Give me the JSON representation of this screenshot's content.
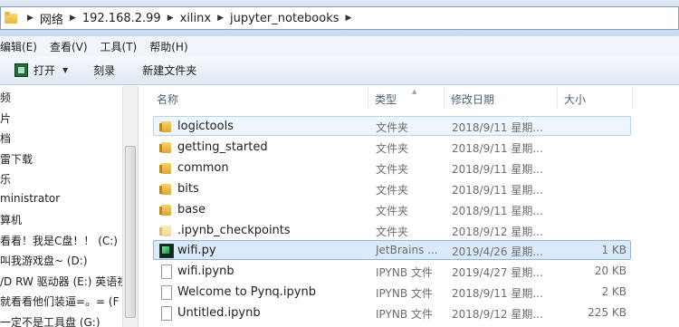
{
  "address": {
    "crumbs": [
      "网络",
      "192.168.2.99",
      "xilinx",
      "jupyter_notebooks"
    ]
  },
  "menu": {
    "items": [
      "编辑(E)",
      "查看(V)",
      "工具(T)",
      "帮助(H)"
    ]
  },
  "toolbar": {
    "open_label": "打开",
    "burn_label": "刻录",
    "new_folder_label": "新建文件夹"
  },
  "nav": {
    "items": [
      "频",
      "片",
      "档",
      "雷下载",
      "乐",
      "ministrator",
      "算机",
      "看看！我是C盘！！ (C:)",
      "叫我游戏盘~ (D:)",
      "/D RW 驱动器 (E:) 英语视",
      "就看看他们装逼=。= (F",
      "一定不是工具盘 (G:)"
    ]
  },
  "columns": {
    "name": "名称",
    "type": "类型",
    "date": "修改日期",
    "size": "大小"
  },
  "files": [
    {
      "name": "logictools",
      "type": "文件夹",
      "date": "2018/9/11 星期...",
      "size": "",
      "icon": "folder-icon"
    },
    {
      "name": "getting_started",
      "type": "文件夹",
      "date": "2018/9/11 星期...",
      "size": "",
      "icon": "folder-icon"
    },
    {
      "name": "common",
      "type": "文件夹",
      "date": "2018/9/11 星期...",
      "size": "",
      "icon": "folder-icon"
    },
    {
      "name": "bits",
      "type": "文件夹",
      "date": "2018/9/11 星期...",
      "size": "",
      "icon": "folder-icon"
    },
    {
      "name": "base",
      "type": "文件夹",
      "date": "2018/9/11 星期...",
      "size": "",
      "icon": "folder-icon"
    },
    {
      "name": ".ipynb_checkpoints",
      "type": "文件夹",
      "date": "2018/9/12 星期...",
      "size": "",
      "icon": "folder-icon"
    },
    {
      "name": "wifi.py",
      "type": "JetBrains ...",
      "date": "2019/4/26 星期...",
      "size": "1 KB",
      "icon": "python-file-icon"
    },
    {
      "name": "wifi.ipynb",
      "type": "IPYNB 文件",
      "date": "2019/4/27 星期...",
      "size": "20 KB",
      "icon": "file-icon"
    },
    {
      "name": "Welcome to Pynq.ipynb",
      "type": "IPYNB 文件",
      "date": "2018/9/11 星期...",
      "size": "2 KB",
      "icon": "file-icon"
    },
    {
      "name": "Untitled.ipynb",
      "type": "IPYNB 文件",
      "date": "2018/9/12 星期...",
      "size": "225 KB",
      "icon": "file-icon"
    }
  ]
}
